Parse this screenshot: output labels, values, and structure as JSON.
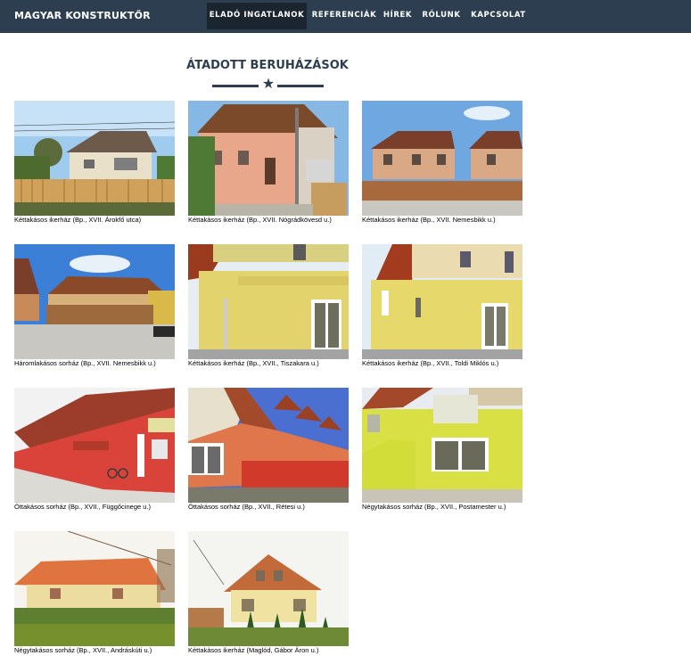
{
  "colors": {
    "navbar": "#2c3e50",
    "nav_active": "#1a252f",
    "text_primary": "#2c3e50"
  },
  "navbar": {
    "brand": "MAGYAR KONSTRUKTŐR",
    "items": [
      {
        "label": "ELADÓ INGATLANOK",
        "active": true
      },
      {
        "label": "REFERENCIÁK",
        "active": false
      },
      {
        "label": "HÍREK",
        "active": false
      },
      {
        "label": "RÓLUNK",
        "active": false
      },
      {
        "label": "KAPCSOLAT",
        "active": false
      }
    ]
  },
  "section": {
    "title": "ÁTADOTT BERUHÁZÁSOK",
    "divider_icon": "star-icon"
  },
  "gallery": [
    {
      "caption": "Kéttakásos ikerház (Bp., XVII. Árokfő utca)",
      "scene": "house-fence"
    },
    {
      "caption": "Kéttakásos ikerház (Bp., XVII. Nógrádkövesd u.)",
      "scene": "pink-house"
    },
    {
      "caption": "Kéttakásos ikerház (Bp., XVII. Nemesbikk u.)",
      "scene": "twin-houses"
    },
    {
      "caption": "Háromlakásos sorház (Bp., XVII. Nemesbikk u.)",
      "scene": "rowhouse-sky"
    },
    {
      "caption": "Kéttakásos ikerház (Bp., XVII., Tiszakara u.)",
      "scene": "yellow-house"
    },
    {
      "caption": "Kéttakásos ikerház (Bp., XVII., Toldi Miklós u.)",
      "scene": "yellow-house-2"
    },
    {
      "caption": "Öttakásos sorház (Bp., XVII., Függőcinege u.)",
      "scene": "red-rowhouse"
    },
    {
      "caption": "Öttakásos sorház (Bp., XVII., Rétesi u.)",
      "scene": "red-rowhouse-2"
    },
    {
      "caption": "Négytakásos sorház (Bp., XVII., Postamester u.)",
      "scene": "yellow-green"
    },
    {
      "caption": "Négytakásos sorház (Bp., XVII., Andráskúti u.)",
      "scene": "garden-house"
    },
    {
      "caption": "Kéttakásos ikerház (Maglód, Gábor Áron u.)",
      "scene": "tree-house"
    }
  ]
}
